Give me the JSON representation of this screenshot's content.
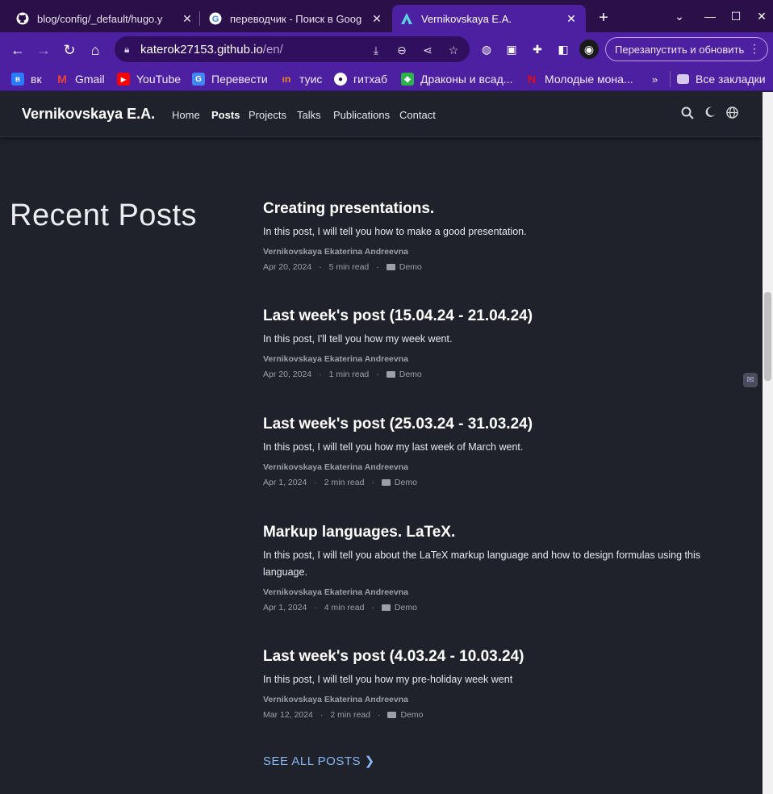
{
  "tabs": [
    {
      "title": "blog/config/_default/hugo.y",
      "favicon": "github-icon"
    },
    {
      "title": "переводчик - Поиск в Goog",
      "favicon": "google-icon"
    },
    {
      "title": "Vernikovskaya E.A.",
      "favicon": "site-icon"
    }
  ],
  "toolbar": {
    "url_host": "katerok27153.github.io",
    "url_path": "/en/",
    "restart_label": "Перезапустить и обновить"
  },
  "bookmarks": [
    {
      "label": "вк",
      "color": "#2a7bff"
    },
    {
      "label": "Gmail",
      "color": "#ea4335"
    },
    {
      "label": "YouTube",
      "color": "#ff0000"
    },
    {
      "label": "Перевести",
      "color": "#4285f4"
    },
    {
      "label": "туис",
      "color": "#f08a24"
    },
    {
      "label": "гитхаб",
      "color": "#ffffff"
    },
    {
      "label": "Драконы и всад...",
      "color": "#2bb24c"
    },
    {
      "label": "Молодые мона...",
      "color": "#e50914"
    }
  ],
  "bookmarks_all": "Все закладки",
  "site": {
    "brand": "Vernikovskaya E.A.",
    "nav": [
      "Home",
      "Posts",
      "Projects",
      "Talks",
      "Publications",
      "Contact"
    ],
    "active_nav": "Posts"
  },
  "section_title": "Recent Posts",
  "posts": [
    {
      "title": "Creating presentations.",
      "summary": "In this post, I will tell you how to make a good presentation.",
      "author": "Vernikovskaya Ekaterina Andreevna",
      "date": "Apr 20, 2024",
      "read": "5 min read",
      "category": "Demo"
    },
    {
      "title": "Last week's post (15.04.24 - 21.04.24)",
      "summary": "In this post, I'll tell you how my week went.",
      "author": "Vernikovskaya Ekaterina Andreevna",
      "date": "Apr 20, 2024",
      "read": "1 min read",
      "category": "Demo"
    },
    {
      "title": "Last week's post (25.03.24 - 31.03.24)",
      "summary": "In this post, I will tell you how my last week of March went.",
      "author": "Vernikovskaya Ekaterina Andreevna",
      "date": "Apr 1, 2024",
      "read": "2 min read",
      "category": "Demo"
    },
    {
      "title": "Markup languages. LaTeX.",
      "summary": "In this post, I will tell you about the LaTeX markup language and how to design formulas using this language.",
      "author": "Vernikovskaya Ekaterina Andreevna",
      "date": "Apr 1, 2024",
      "read": "4 min read",
      "category": "Demo"
    },
    {
      "title": "Last week's post (4.03.24 - 10.03.24)",
      "summary": "In this post, I will tell you how my pre-holiday week went",
      "author": "Vernikovskaya Ekaterina Andreevna",
      "date": "Mar 12, 2024",
      "read": "2 min read",
      "category": "Demo"
    }
  ],
  "see_all": "SEE ALL POSTS",
  "colors": {
    "tab_strip": "#2b0f49",
    "toolbar": "#4d20a1",
    "page_bg": "#1f222a",
    "link": "#8ab8f4"
  }
}
